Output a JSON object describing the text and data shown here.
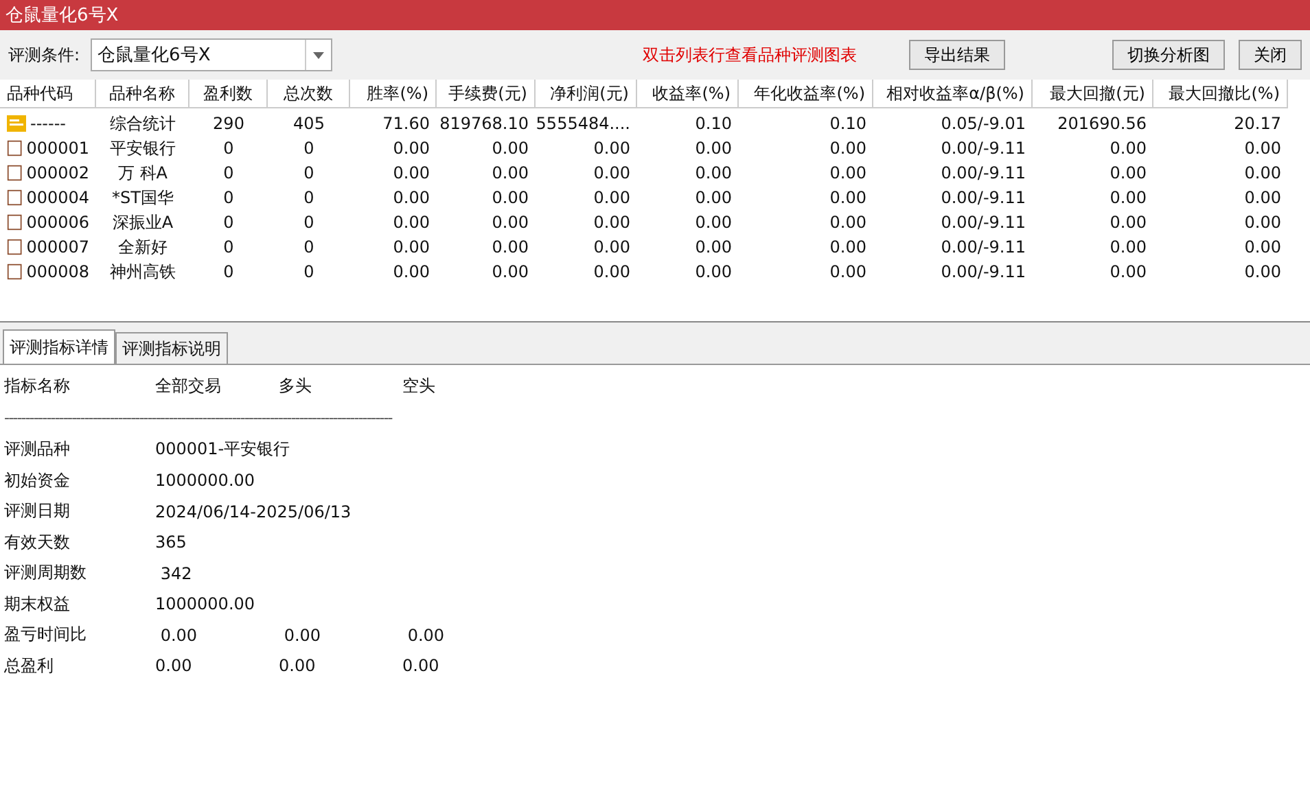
{
  "window": {
    "title": "仓鼠量化6号X"
  },
  "toolbar": {
    "condition_label": "评测条件:",
    "condition_value": "仓鼠量化6号X",
    "hint": "双击列表行查看品种评测图表",
    "buttons": [
      {
        "label": "导出结果"
      },
      {
        "label": "切换分析图"
      },
      {
        "label": "关闭"
      }
    ]
  },
  "table": {
    "columns": [
      {
        "label": "品种代码"
      },
      {
        "label": "品种名称"
      },
      {
        "label": "盈利数"
      },
      {
        "label": "总次数"
      },
      {
        "label": "胜率(%)"
      },
      {
        "label": "手续费(元)"
      },
      {
        "label": "净利润(元)"
      },
      {
        "label": "收益率(%)"
      },
      {
        "label": "年化收益率(%)"
      },
      {
        "label": "相对收益率α/β(%)"
      },
      {
        "label": "最大回撤(元)"
      },
      {
        "label": "最大回撤比(%)"
      }
    ],
    "rows": [
      {
        "kind": "summary",
        "cells": [
          "------",
          "综合统计",
          "290",
          "405",
          "71.60",
          "819768.10",
          "5555484....",
          "0.10",
          "0.10",
          "0.05/-9.01",
          "201690.56",
          "20.17"
        ]
      },
      {
        "kind": "stock",
        "cells": [
          "000001",
          "平安银行",
          "0",
          "0",
          "0.00",
          "0.00",
          "0.00",
          "0.00",
          "0.00",
          "0.00/-9.11",
          "0.00",
          "0.00"
        ]
      },
      {
        "kind": "stock",
        "cells": [
          "000002",
          "万 科A",
          "0",
          "0",
          "0.00",
          "0.00",
          "0.00",
          "0.00",
          "0.00",
          "0.00/-9.11",
          "0.00",
          "0.00"
        ]
      },
      {
        "kind": "stock",
        "cells": [
          "000004",
          "*ST国华",
          "0",
          "0",
          "0.00",
          "0.00",
          "0.00",
          "0.00",
          "0.00",
          "0.00/-9.11",
          "0.00",
          "0.00"
        ]
      },
      {
        "kind": "stock",
        "cells": [
          "000006",
          "深振业A",
          "0",
          "0",
          "0.00",
          "0.00",
          "0.00",
          "0.00",
          "0.00",
          "0.00/-9.11",
          "0.00",
          "0.00"
        ]
      },
      {
        "kind": "stock",
        "cells": [
          "000007",
          "全新好",
          "0",
          "0",
          "0.00",
          "0.00",
          "0.00",
          "0.00",
          "0.00",
          "0.00/-9.11",
          "0.00",
          "0.00"
        ]
      },
      {
        "kind": "stock",
        "cells": [
          "000008",
          "神州高铁",
          "0",
          "0",
          "0.00",
          "0.00",
          "0.00",
          "0.00",
          "0.00",
          "0.00/-9.11",
          "0.00",
          "0.00"
        ]
      }
    ]
  },
  "tabs": [
    {
      "label": "评测指标详情",
      "selected": true
    },
    {
      "label": "评测指标说明",
      "selected": false
    }
  ],
  "details": {
    "headers": [
      "指标名称",
      "全部交易",
      "多头",
      "空头"
    ],
    "separator": "--------------------------------------------------------------------------------------------",
    "rows": [
      {
        "values": [
          "评测品种",
          "000001-平安银行"
        ]
      },
      {
        "values": [
          "初始资金",
          "1000000.00"
        ]
      },
      {
        "values": [
          "评测日期",
          "2024/06/14-2025/06/13"
        ]
      },
      {
        "values": [
          "有效天数",
          "365"
        ]
      },
      {
        "values": [
          "评测周期数",
          " 342"
        ]
      },
      {
        "values": [
          "期末权益",
          "1000000.00"
        ]
      },
      {
        "values": [
          "盈亏时间比",
          " 0.00",
          " 0.00",
          " 0.00"
        ]
      },
      {
        "values": [
          "总盈利",
          "0.00",
          "0.00",
          "0.00"
        ]
      }
    ]
  }
}
